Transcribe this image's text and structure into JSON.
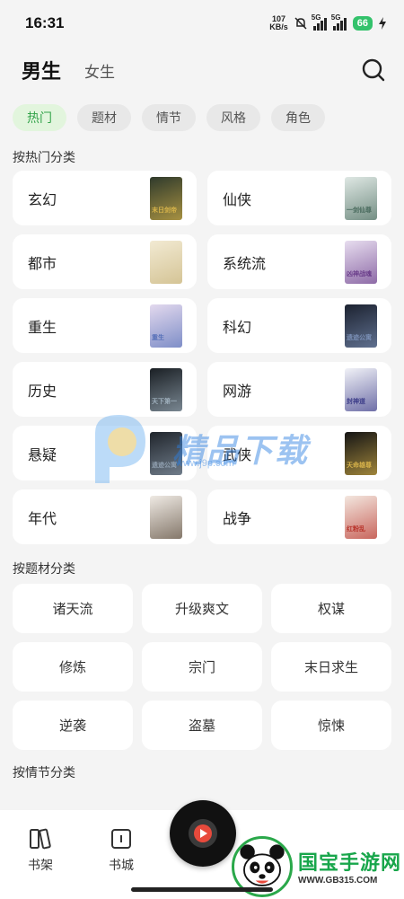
{
  "status": {
    "time": "16:31",
    "net_speed_value": "107",
    "net_speed_unit": "KB/s",
    "sig1_label": "5G",
    "sig2_label": "5G",
    "battery": "66"
  },
  "header": {
    "tab_male": "男生",
    "tab_female": "女生",
    "search_icon": "search-icon"
  },
  "filter_chips": [
    "热门",
    "题材",
    "情节",
    "风格",
    "角色"
  ],
  "sections": {
    "hot": "按热门分类",
    "theme": "按题材分类",
    "plot": "按情节分类"
  },
  "hot_categories": [
    {
      "name": "玄幻",
      "cover_color": "#2f3a2c",
      "cover_accent": "#d6b34a",
      "cover_text": "末日剑帝"
    },
    {
      "name": "仙侠",
      "cover_color": "#dfe8e4",
      "cover_accent": "#4a6b5e",
      "cover_text": "一剑仙尊"
    },
    {
      "name": "都市",
      "cover_color": "#f2ead3",
      "cover_accent": "#c9b57d",
      "cover_text": ""
    },
    {
      "name": "系统流",
      "cover_color": "#e7ddef",
      "cover_accent": "#6a3d8a",
      "cover_text": "凶神战魂"
    },
    {
      "name": "重生",
      "cover_color": "#e3d9ee",
      "cover_accent": "#5670b8",
      "cover_text": "重生"
    },
    {
      "name": "科幻",
      "cover_color": "#1c2230",
      "cover_accent": "#7a8fb5",
      "cover_text": "遗迹公寓"
    },
    {
      "name": "历史",
      "cover_color": "#1a1f24",
      "cover_accent": "#9fb0bd",
      "cover_text": "天下第一"
    },
    {
      "name": "网游",
      "cover_color": "#f1f2f7",
      "cover_accent": "#3b3b88",
      "cover_text": "封神道"
    },
    {
      "name": "悬疑",
      "cover_color": "#20252c",
      "cover_accent": "#90a0b0",
      "cover_text": "遗迹公寓"
    },
    {
      "name": "武侠",
      "cover_color": "#151515",
      "cover_accent": "#d7b24a",
      "cover_text": "天命雄尊"
    },
    {
      "name": "年代",
      "cover_color": "#efeae4",
      "cover_accent": "#5a4a3a",
      "cover_text": ""
    },
    {
      "name": "战争",
      "cover_color": "#f3e7df",
      "cover_accent": "#b8332a",
      "cover_text": "红粉乱"
    }
  ],
  "theme_tags": [
    "诸天流",
    "升级爽文",
    "权谋",
    "修炼",
    "宗门",
    "末日求生",
    "逆袭",
    "盗墓",
    "惊悚"
  ],
  "watermark": {
    "brand": "精品下载",
    "url": "www.j9p.com"
  },
  "bottom_nav": {
    "bookshelf": "书架",
    "bookstore": "书城"
  },
  "panda_watermark": {
    "title": "国宝手游网",
    "url": "WWW.GB315.COM"
  },
  "colors": {
    "accent_green": "#33a34a",
    "chip_active_bg": "#e2f5dd",
    "watermark_blue": "#2b7fe0",
    "player_red": "#e84a3c"
  }
}
